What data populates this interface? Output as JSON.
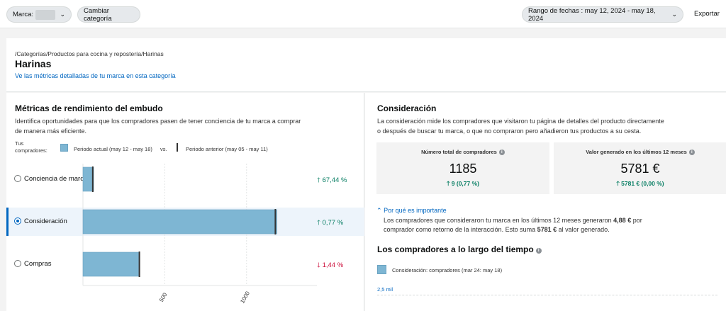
{
  "toolbar": {
    "brand_label": "Marca:",
    "change_category_label": "Cambiar categoría",
    "date_range_label": "Rango de fechas : may 12, 2024 - may 18, 2024",
    "export_label": "Exportar"
  },
  "header": {
    "breadcrumb": "/Categorías/Productos para cocina y repostería/Harinas",
    "title": "Harinas",
    "link": "Ve las métricas detalladas de tu marca en esta categoría"
  },
  "funnel": {
    "title": "Métricas de rendimiento del embudo",
    "description_line1": "Identifica oportunidades para que los compradores pasen de tener conciencia de tu marca a comprar",
    "description_line2": "de manera más eficiente.",
    "legend": {
      "prefix_line1": "Tus",
      "prefix_line2": "compradores:",
      "current": "Periodo actual (may 12 - may 18)",
      "vs": "vs.",
      "previous": "Periodo anterior (may 05 - may 11)"
    },
    "rows": [
      {
        "label": "Conciencia de marca",
        "delta": "67,44 %",
        "direction": "up",
        "selected": false
      },
      {
        "label": "Consideración",
        "delta": "0,77 %",
        "direction": "up",
        "selected": true
      },
      {
        "label": "Compras",
        "delta": "1,44 %",
        "direction": "down",
        "selected": false
      }
    ]
  },
  "chart_data": {
    "type": "bar",
    "orientation": "horizontal",
    "categories": [
      "Conciencia de marca",
      "Consideración",
      "Compras"
    ],
    "series": [
      {
        "name": "Periodo actual (may 12 - may 18)",
        "values": [
          65,
          1185,
          340
        ]
      },
      {
        "name": "Periodo anterior (may 05 - may 11)",
        "values": [
          60,
          1176,
          345
        ]
      }
    ],
    "x_ticks": [
      "500",
      "1000"
    ],
    "x_tick_values": [
      500,
      1000
    ],
    "xlim": [
      0,
      1430
    ],
    "colors": {
      "current": "#7eb6d3",
      "previous": "#333333"
    }
  },
  "consideration": {
    "title": "Consideración",
    "description_line1": "La consideración mide los compradores que visitaron tu página de detalles del producto directamente",
    "description_line2": "o después de buscar tu marca, o que no compraron pero añadieron tus productos a su cesta.",
    "kpis": [
      {
        "title": "Número total de compradores",
        "value": "1185",
        "delta": "9 (0,77 %)"
      },
      {
        "title": "Valor generado en los últimos 12 meses",
        "value": "5781 €",
        "delta": "5781 € (0,00 %)"
      }
    ],
    "why_link": "Por qué es importante",
    "why_line1_a": "Los compradores que consideraron tu marca en los últimos 12 meses generaron ",
    "why_line1_b": "4,88 €",
    "why_line1_c": " por",
    "why_line2_a": "comprador como retorno de la interacción. Esto suma ",
    "why_line2_b": "5781 €",
    "why_line2_c": " al valor generado."
  },
  "over_time": {
    "title": "Los compradores a lo largo del tiempo",
    "legend": "Consideración: compradores (mar 24: may 18)",
    "y_tick": "2,5 mil"
  }
}
